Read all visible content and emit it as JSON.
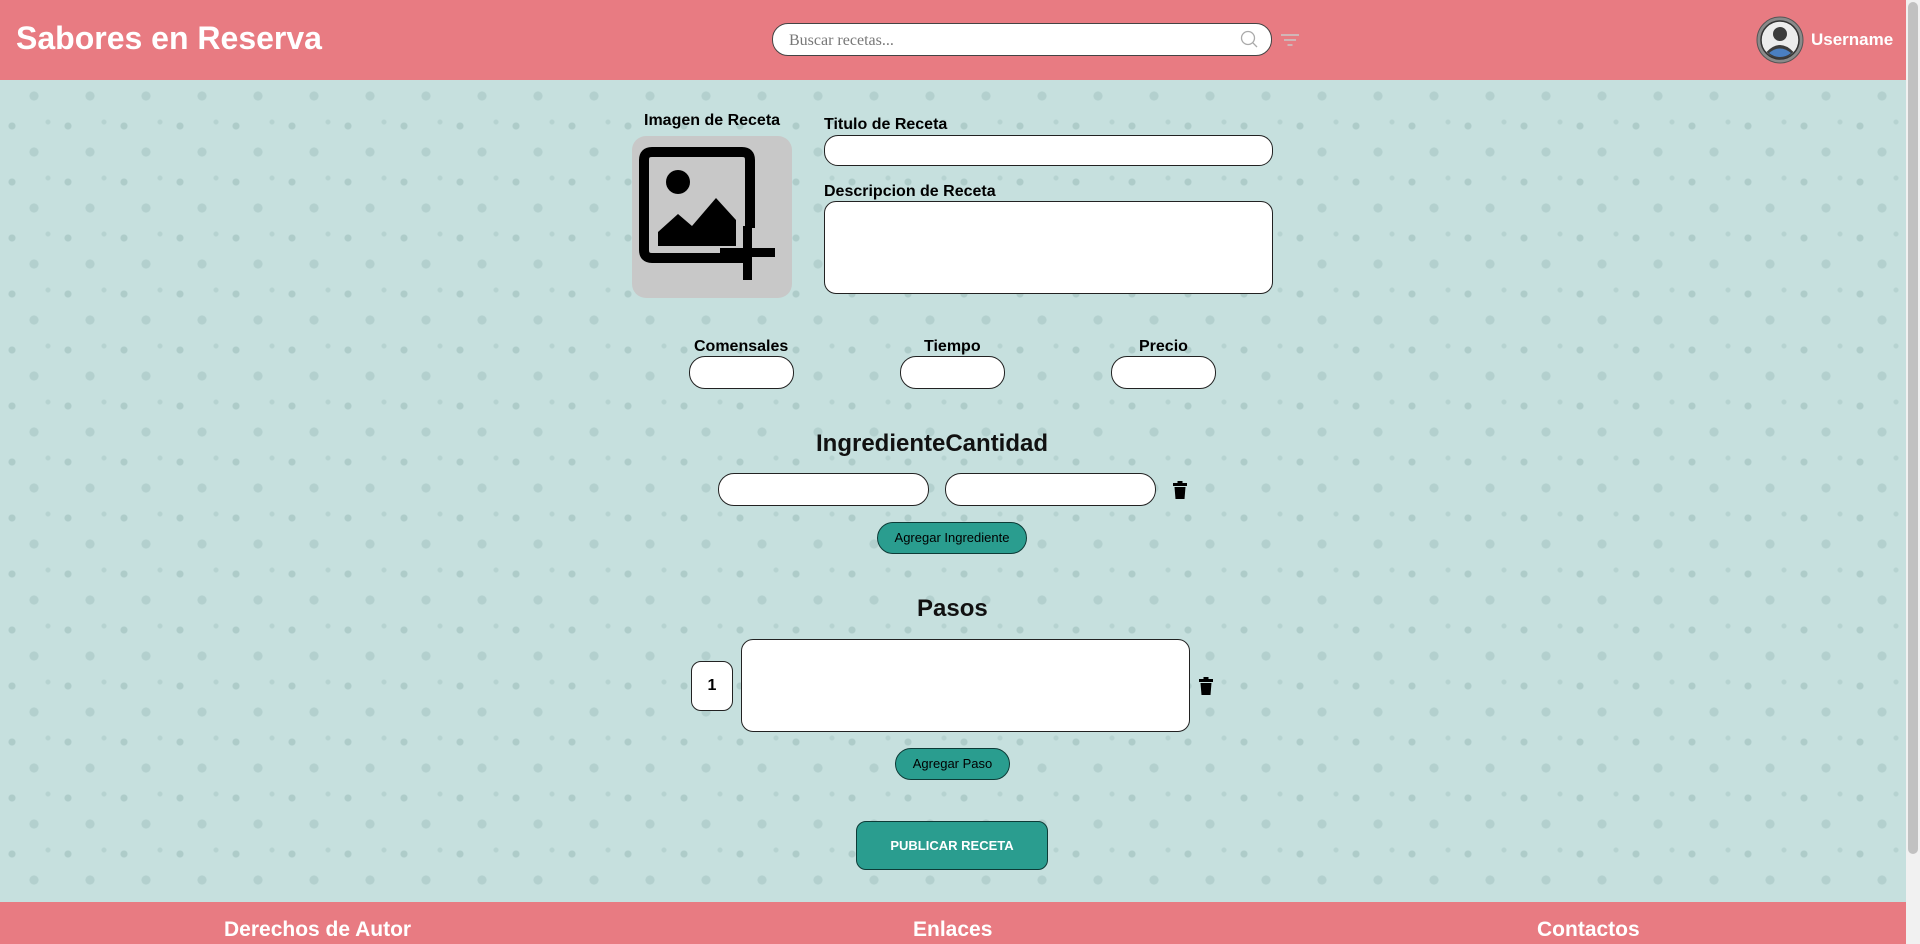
{
  "header": {
    "brand": "Sabores en Reserva",
    "search_placeholder": "Buscar recetas...",
    "username": "Username"
  },
  "form": {
    "image_label": "Imagen de Receta",
    "title_label": "Titulo de Receta",
    "description_label": "Descripcion de Receta",
    "servings_label": "Comensales",
    "time_label": "Tiempo",
    "price_label": "Precio"
  },
  "ingredients": {
    "header": "IngredienteCantidad",
    "add_label": "Agregar Ingrediente"
  },
  "steps": {
    "header": "Pasos",
    "items": [
      {
        "number": "1"
      }
    ],
    "add_label": "Agregar Paso"
  },
  "publish_label": "PUBLICAR RECETA",
  "footer": {
    "copyright": "Derechos de Autor",
    "links": "Enlaces",
    "contacts": "Contactos"
  },
  "colors": {
    "header_bg": "#e87b82",
    "accent": "#2a9d8f",
    "page_bg": "#c6e0de"
  }
}
